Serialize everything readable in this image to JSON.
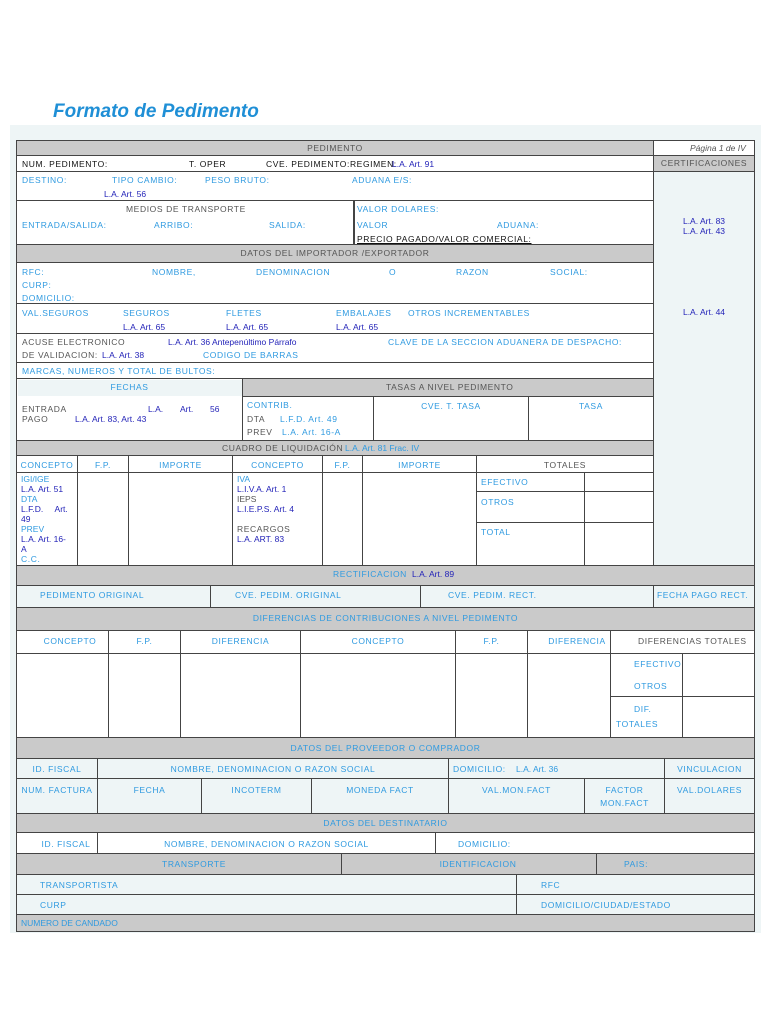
{
  "title": "Formato de Pedimento",
  "header": {
    "pedimento": "PEDIMENTO",
    "pagina": "Página 1 de IV",
    "certificaciones": "CERTIFICACIONES",
    "cert_ref1": "L.A. Art. 83",
    "cert_ref2": "L.A. Art. 43",
    "cert_ref3": "L.A. Art. 44"
  },
  "row1": {
    "num": "NUM. PEDIMENTO:",
    "toper": "T. OPER",
    "cve": "CVE. PEDIMENTO:REGIMEN:",
    "cve_ref": "L.A. Art. 91"
  },
  "row2": {
    "destino": "DESTINO:",
    "tipo": "TIPO CAMBIO:",
    "peso": "PESO BRUTO:",
    "aduana": "ADUANA E/S:",
    "ref": "L.A. Art. 56"
  },
  "row3": {
    "medios": "MEDIOS DE TRANSPORTE",
    "entrada": "ENTRADA/SALIDA:",
    "arribo": "ARRIBO:",
    "salida": "SALIDA:",
    "valor_dolares": "VALOR DOLARES:",
    "valor": "VALOR",
    "aduana": "ADUANA:",
    "precio": "PRECIO PAGADO/VALOR COMERCIAL:"
  },
  "importador": {
    "title": "DATOS DEL IMPORTADOR /EXPORTADOR",
    "rfc": "RFC:",
    "nombre": "NOMBRE,",
    "denominacion": "DENOMINACION",
    "o": "O",
    "razon": "RAZON",
    "social": "SOCIAL:",
    "curp": "CURP:",
    "domicilio": "DOMICILIO:"
  },
  "valores": {
    "val_seguros": "VAL.SEGUROS",
    "seguros": "SEGUROS",
    "fletes": "FLETES",
    "embalajes": "EMBALAJES",
    "otros": "OTROS INCREMENTABLES",
    "ref": "L.A. Art. 65"
  },
  "acuse": {
    "acuse": "ACUSE ELECTRONICO",
    "acuse_ref": "L.A. Art. 36 Antepenúltimo Párrafo",
    "clave": "CLAVE DE LA SECCION ADUANERA DE DESPACHO:",
    "validacion": "DE VALIDACION:",
    "validacion_ref": "L.A. Art. 38",
    "codigo": "CODIGO DE BARRAS"
  },
  "marcas": "MARCAS, NUMEROS Y TOTAL DE BULTOS:",
  "fechas": {
    "title": "FECHAS",
    "entrada": "ENTRADA",
    "entrada_ref1": "L.A.",
    "entrada_ref2": "Art.",
    "entrada_ref3": "56",
    "pago": "PAGO",
    "pago_ref": "L.A. Art. 83,  Art. 43"
  },
  "tasas": {
    "title": "TASAS A NIVEL PEDIMENTO",
    "contrib": "CONTRIB.",
    "dta": "DTA",
    "dta_ref": "L.F.D. Art. 49",
    "prev": "PREV",
    "prev_ref": "L.A. Art. 16-A",
    "cve": "CVE. T. TASA",
    "tasa": "TASA"
  },
  "cuadro": {
    "title": "CUADRO DE LIQUIDACIÓN",
    "title_ref": "L.A. Art. 81 Frac. IV",
    "concepto": "CONCEPTO",
    "fp": "F.P.",
    "importe": "IMPORTE",
    "totales": "TOTALES",
    "igi": "IGI/IGE",
    "igi_ref": "L.A. Art. 51",
    "dta": "DTA",
    "dta_ref1": "L.F.D.     Art.",
    "dta_ref2": "49",
    "prev": "PREV",
    "prev_ref1": "L.A. Art. 16-",
    "prev_ref2": "A",
    "cc": "C.C.",
    "iva": "IVA",
    "iva_ref": "L.I.V.A. Art. 1",
    "ieps": "IEPS",
    "ieps_ref": "L.I.E.P.S. Art. 4",
    "recargos": "RECARGOS",
    "recargos_ref": "L.A. ART. 83",
    "efectivo": "EFECTIVO",
    "otros": "OTROS",
    "total": "TOTAL"
  },
  "rectificacion": {
    "title": "RECTIFICACION",
    "ref": "L.A. Art. 89",
    "original": "PEDIMENTO ORIGINAL",
    "cve_original": "CVE. PEDIM. ORIGINAL",
    "cve_rect": "CVE. PEDIM. RECT.",
    "fecha": "FECHA PAGO RECT."
  },
  "diferencias": {
    "title": "DIFERENCIAS DE CONTRIBUCIONES A NIVEL PEDIMENTO",
    "concepto": "CONCEPTO",
    "fp": "F.P.",
    "diferencia": "DIFERENCIA",
    "totales": "DIFERENCIAS TOTALES",
    "efectivo": "EFECTIVO",
    "otros": "OTROS",
    "dif": "DIF.",
    "dif_totales": "TOTALES"
  },
  "proveedor": {
    "title": "DATOS DEL PROVEEDOR O COMPRADOR",
    "id": "ID. FISCAL",
    "nombre": "NOMBRE, DENOMINACION O RAZON SOCIAL",
    "domicilio": "DOMICILIO:",
    "domicilio_ref": "L.A. Art. 36",
    "vinculacion": "VINCULACION",
    "factura": "NUM. FACTURA",
    "fecha": "FECHA",
    "incoterm": "INCOTERM",
    "moneda": "MONEDA FACT",
    "val_mon": "VAL.MON.FACT",
    "factor1": "FACTOR",
    "factor2": "MON.FACT",
    "val_dolares": "VAL.DOLARES"
  },
  "destinatario": {
    "title": "DATOS DEL DESTINATARIO",
    "id": "ID. FISCAL",
    "nombre": "NOMBRE, DENOMINACION O RAZON SOCIAL",
    "domicilio": "DOMICILIO:"
  },
  "transporte": {
    "transporte": "TRANSPORTE",
    "identificacion": "IDENTIFICACION",
    "pais": "PAIS:",
    "transportista": "TRANSPORTISTA",
    "rfc": "RFC",
    "curp": "CURP",
    "domicilio": "DOMICILIO/CIUDAD/ESTADO",
    "candado": "NUMERO DE CANDADO"
  }
}
